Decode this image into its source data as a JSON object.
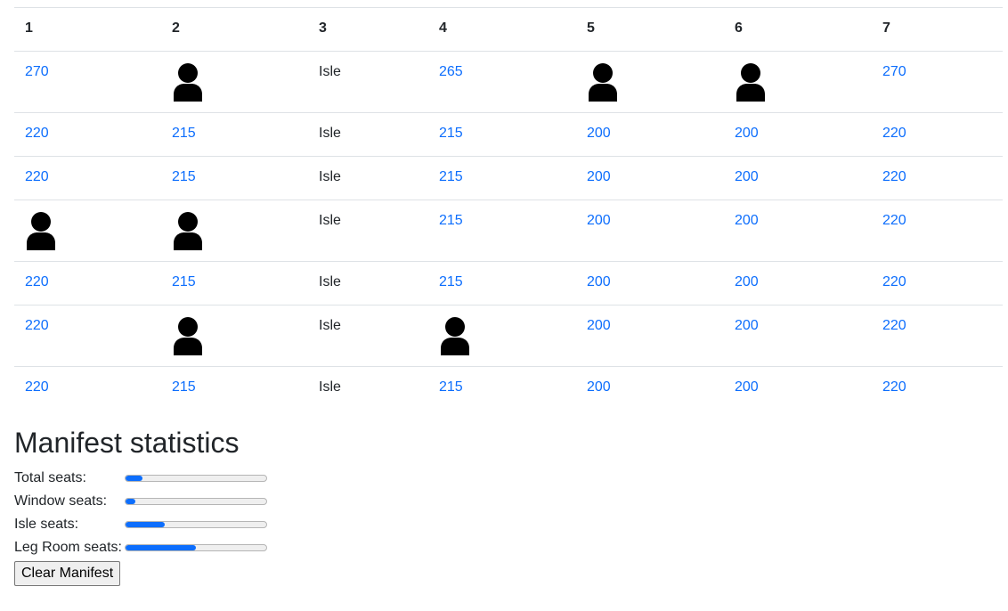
{
  "seat_map": {
    "columns": [
      "1",
      "2",
      "3",
      "4",
      "5",
      "6",
      "7"
    ],
    "rows": [
      [
        {
          "t": "price",
          "v": "270"
        },
        {
          "t": "person"
        },
        {
          "t": "aisle",
          "v": "Isle"
        },
        {
          "t": "price",
          "v": "265"
        },
        {
          "t": "person"
        },
        {
          "t": "person"
        },
        {
          "t": "price",
          "v": "270"
        }
      ],
      [
        {
          "t": "price",
          "v": "220"
        },
        {
          "t": "price",
          "v": "215"
        },
        {
          "t": "aisle",
          "v": "Isle"
        },
        {
          "t": "price",
          "v": "215"
        },
        {
          "t": "price",
          "v": "200"
        },
        {
          "t": "price",
          "v": "200"
        },
        {
          "t": "price",
          "v": "220"
        }
      ],
      [
        {
          "t": "price",
          "v": "220"
        },
        {
          "t": "price",
          "v": "215"
        },
        {
          "t": "aisle",
          "v": "Isle"
        },
        {
          "t": "price",
          "v": "215"
        },
        {
          "t": "price",
          "v": "200"
        },
        {
          "t": "price",
          "v": "200"
        },
        {
          "t": "price",
          "v": "220"
        }
      ],
      [
        {
          "t": "person"
        },
        {
          "t": "person"
        },
        {
          "t": "aisle",
          "v": "Isle"
        },
        {
          "t": "price",
          "v": "215"
        },
        {
          "t": "price",
          "v": "200"
        },
        {
          "t": "price",
          "v": "200"
        },
        {
          "t": "price",
          "v": "220"
        }
      ],
      [
        {
          "t": "price",
          "v": "220"
        },
        {
          "t": "price",
          "v": "215"
        },
        {
          "t": "aisle",
          "v": "Isle"
        },
        {
          "t": "price",
          "v": "215"
        },
        {
          "t": "price",
          "v": "200"
        },
        {
          "t": "price",
          "v": "200"
        },
        {
          "t": "price",
          "v": "220"
        }
      ],
      [
        {
          "t": "price",
          "v": "220"
        },
        {
          "t": "person"
        },
        {
          "t": "aisle",
          "v": "Isle"
        },
        {
          "t": "person"
        },
        {
          "t": "price",
          "v": "200"
        },
        {
          "t": "price",
          "v": "200"
        },
        {
          "t": "price",
          "v": "220"
        }
      ],
      [
        {
          "t": "price",
          "v": "220"
        },
        {
          "t": "price",
          "v": "215"
        },
        {
          "t": "aisle",
          "v": "Isle"
        },
        {
          "t": "price",
          "v": "215"
        },
        {
          "t": "price",
          "v": "200"
        },
        {
          "t": "price",
          "v": "200"
        },
        {
          "t": "price",
          "v": "220"
        }
      ]
    ]
  },
  "stats": {
    "title": "Manifest statistics",
    "items": [
      {
        "label": "Total seats:",
        "fraction": 0.12
      },
      {
        "label": "Window seats:",
        "fraction": 0.07
      },
      {
        "label": "Isle seats:",
        "fraction": 0.28
      },
      {
        "label": "Leg Room seats:",
        "fraction": 0.5
      }
    ],
    "clear_label": "Clear Manifest"
  },
  "colors": {
    "link": "#0d6efd",
    "bar_fill": "#0d6efd",
    "text": "#212529"
  },
  "icons": {
    "occupied": "person-icon"
  }
}
